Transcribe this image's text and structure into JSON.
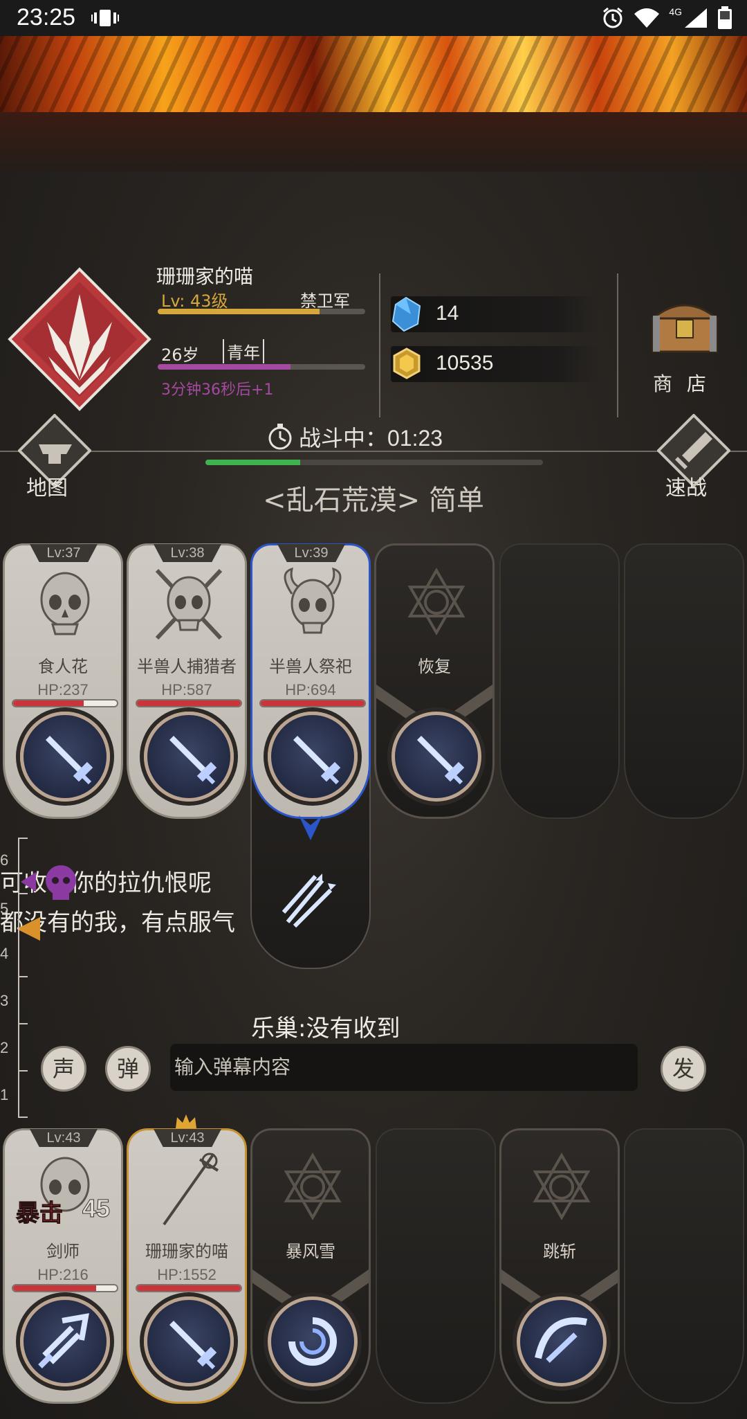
{
  "status_bar": {
    "time": "23:25",
    "network": "4G"
  },
  "player": {
    "name": "珊珊家的喵",
    "level": "Lv: 43级",
    "rank": "禁卫军",
    "level_progress": 0.78,
    "age": "26岁",
    "stage": "青年",
    "age_progress": 0.64,
    "age_timer": "3分钟36秒后+1"
  },
  "resources": {
    "gems": "14",
    "gold": "10535"
  },
  "shop_label": "商 店",
  "nav": {
    "map_label": "地图",
    "quick_battle_label": "速战"
  },
  "battle": {
    "status_label": "战斗中：",
    "time": "01:23",
    "progress": 0.28,
    "stage_title": "<乱石荒漠> 简单"
  },
  "enemies": [
    {
      "level": "Lv:37",
      "name": "食人花",
      "hp": "HP:237",
      "hp_fraction": 0.68,
      "skill_icon": "sword-icon"
    },
    {
      "level": "Lv:38",
      "name": "半兽人捕猎者",
      "hp": "HP:587",
      "hp_fraction": 1.0,
      "skill_icon": "sword-icon"
    },
    {
      "level": "Lv:39",
      "name": "半兽人祭祀",
      "hp": "HP:694",
      "hp_fraction": 1.0,
      "skill_icon": "sword-icon",
      "selected": true
    },
    {
      "name": "恢复",
      "skill_icon": "sword-icon"
    }
  ],
  "chat": [
    "可收下你的拉仇恨呢",
    "都没有的我，有点服气"
  ],
  "ruler_numbers": [
    "6",
    "5",
    "4",
    "3",
    "2",
    "1"
  ],
  "notice": "乐巢:没有收到",
  "controls": {
    "voice": "声",
    "danmu": "弹",
    "danmu_placeholder": "输入弹幕内容",
    "send": "发"
  },
  "allies": [
    {
      "level": "Lv:43",
      "name": "剑师",
      "hp": "HP:216",
      "hp_fraction": 0.8,
      "skill_icon": "burst-sword-icon",
      "crit_label": "暴击",
      "crit_value": "45"
    },
    {
      "level": "Lv:43",
      "name": "珊珊家的喵",
      "hp": "HP:1552",
      "hp_fraction": 1.0,
      "skill_icon": "sword-icon",
      "leader": true
    },
    {
      "name": "暴风雪",
      "skill_icon": "swirl-icon"
    },
    {
      "name": "跳斩",
      "skill_icon": "slash-sword-icon"
    }
  ],
  "colors": {
    "exp_bar": "#d6a73b",
    "age_bar": "#a44aa0",
    "battle_progress": "#3fb34f",
    "hp_bar": "#c9353a",
    "selected_border": "#2b55c9",
    "leader_border": "#c79232"
  }
}
